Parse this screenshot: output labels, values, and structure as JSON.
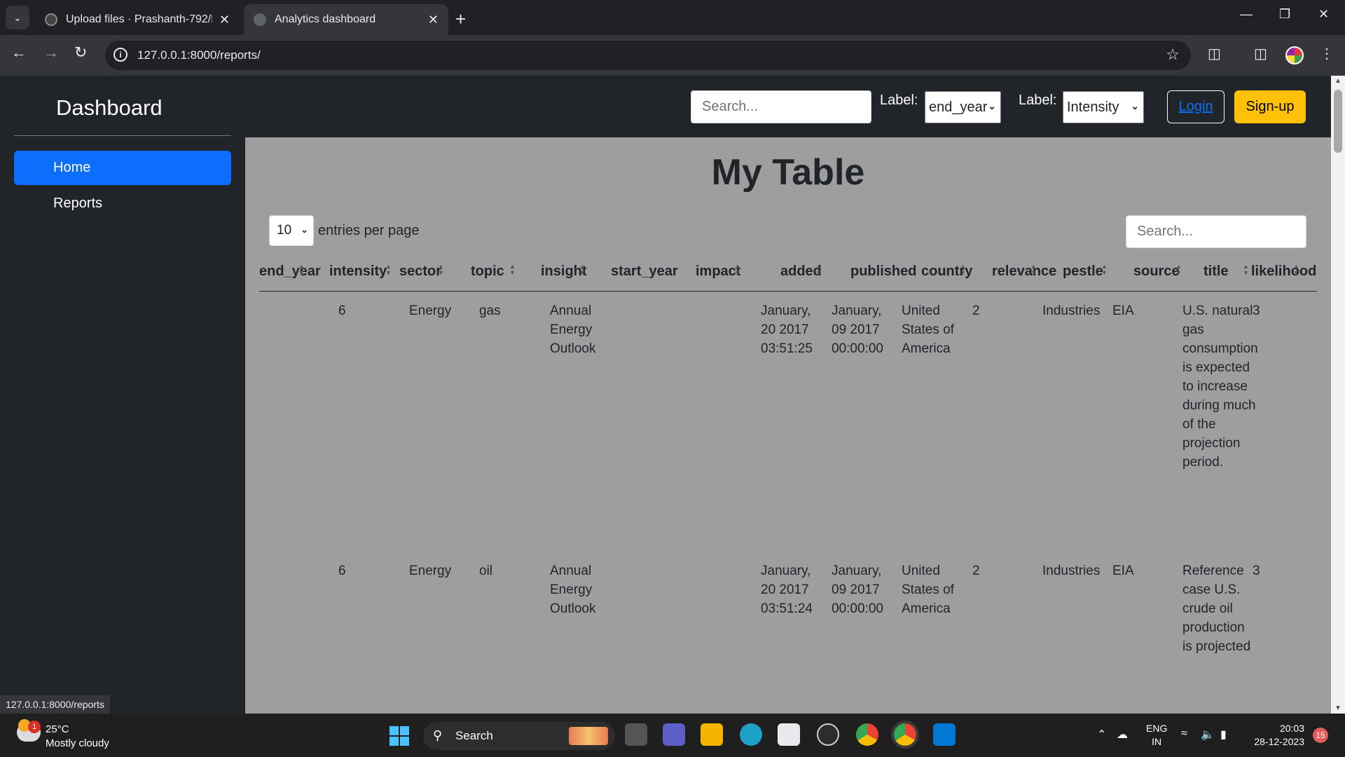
{
  "browser": {
    "tabs": [
      {
        "title": "Upload files · Prashanth-792/Dj",
        "active": false
      },
      {
        "title": "Analytics dashboard",
        "active": true
      }
    ],
    "url": "127.0.0.1:8000/reports/",
    "status_url": "127.0.0.1:8000/reports"
  },
  "sidebar": {
    "brand": "Dashboard",
    "items": [
      {
        "label": "Home",
        "active": true
      },
      {
        "label": "Reports",
        "active": false
      }
    ]
  },
  "topnav": {
    "search_placeholder": "Search...",
    "label1": "Label:",
    "select1_value": "end_year",
    "label2": "Label:",
    "select2_value": "Intensity",
    "login": "Login",
    "signup": "Sign-up"
  },
  "main": {
    "title": "My Table",
    "per_page_value": "10",
    "per_page_label": "entries per page",
    "search_placeholder": "Search...",
    "columns": [
      "end_year",
      "intensity",
      "sector",
      "topic",
      "insight",
      "start_year",
      "impact",
      "added",
      "published",
      "country",
      "relevance",
      "pestle",
      "source",
      "title",
      "likelihood"
    ],
    "rows": [
      {
        "end_year": "",
        "intensity": "6",
        "sector": "Energy",
        "topic": "gas",
        "insight": "Annual Energy Outlook",
        "start_year": "",
        "impact": "",
        "added": "January, 20 2017 03:51:25",
        "published": "January, 09 2017 00:00:00",
        "country": "United States of America",
        "relevance": "2",
        "pestle": "Industries",
        "source": "EIA",
        "title": "U.S. natural gas consumption is expected to increase during much of the projection period.",
        "likelihood": "3"
      },
      {
        "end_year": "",
        "intensity": "6",
        "sector": "Energy",
        "topic": "oil",
        "insight": "Annual Energy Outlook",
        "start_year": "",
        "impact": "",
        "added": "January, 20 2017 03:51:24",
        "published": "January, 09 2017 00:00:00",
        "country": "United States of America",
        "relevance": "2",
        "pestle": "Industries",
        "source": "EIA",
        "title": "Reference case U.S. crude oil production is projected",
        "likelihood": "3"
      }
    ]
  },
  "taskbar": {
    "weather_temp": "25°C",
    "weather_desc": "Mostly cloudy",
    "weather_badge": "1",
    "search_label": "Search",
    "lang_top": "ENG",
    "lang_bottom": "IN",
    "time": "20:03",
    "date": "28-12-2023",
    "notifications": "15"
  },
  "colors": {
    "primary": "#0d6efd",
    "warning": "#ffc107",
    "dark": "#212529",
    "content_bg": "#9e9e9e"
  }
}
